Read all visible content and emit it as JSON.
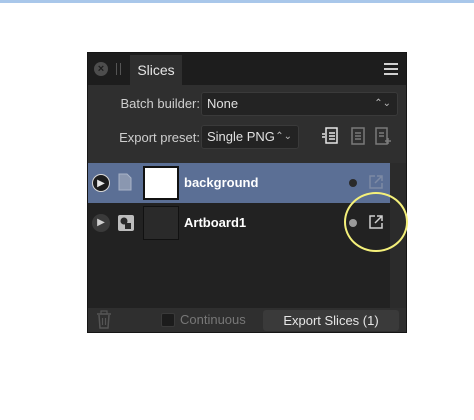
{
  "panel": {
    "tab_label": "Slices",
    "icons": {
      "close": "close-icon",
      "grip": "grip-icon",
      "menu": "hamburger-menu-icon"
    }
  },
  "batch_builder": {
    "label": "Batch builder:",
    "value": "None"
  },
  "export_preset": {
    "label": "Export preset:",
    "value": "Single PNG",
    "icons": [
      "preset-list-icon",
      "preset-document-icon",
      "preset-add-icon"
    ]
  },
  "slices": [
    {
      "name": "background",
      "selected": true,
      "type_icon": "document-icon",
      "thumb": "white"
    },
    {
      "name": "Artboard1",
      "selected": false,
      "type_icon": "artboard-icon",
      "thumb": "dark"
    }
  ],
  "footer": {
    "continuous_label": "Continuous",
    "export_label": "Export Slices (1)"
  },
  "colors": {
    "selection": "#5b6f95",
    "highlight": "#f4f07a",
    "panel_bg": "#2f2f2f"
  }
}
